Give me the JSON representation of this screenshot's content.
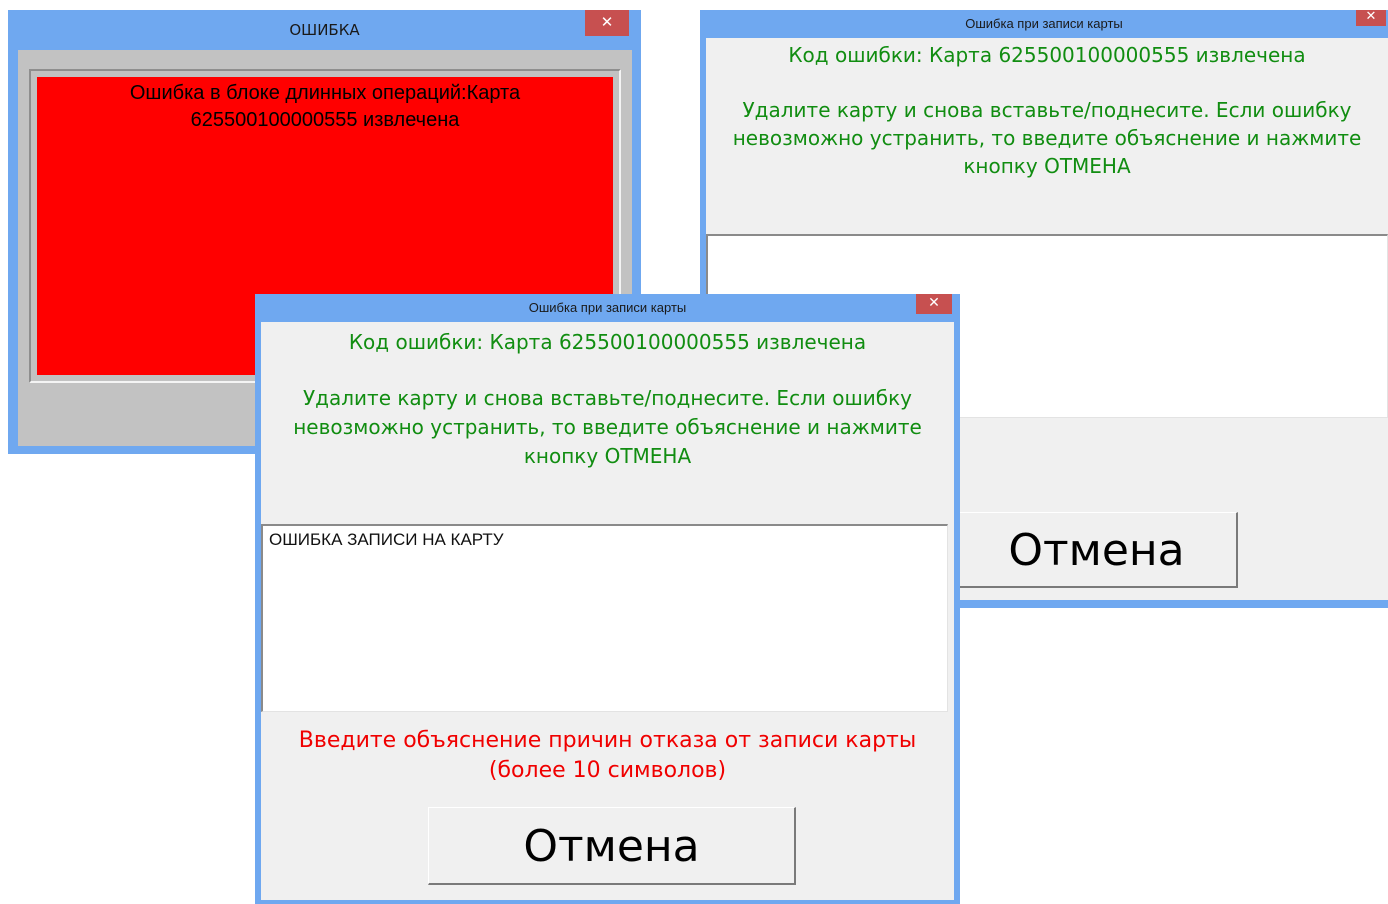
{
  "window_error": {
    "title": "ОШИБКА",
    "close_glyph": "✕",
    "message_line1": "Ошибка в блоке длинных операций:Карта",
    "message_line2": "625500100000555 извлечена",
    "message_bg_color": "#ff0000"
  },
  "window_back": {
    "title": "Ошибка при записи карты",
    "close_glyph": "✕",
    "error_code": "Код ошибки: Карта 625500100000555 извлечена",
    "info_line1": "Удалите карту и снова вставьте/поднесите. Если ошибку",
    "info_line2": "невозможно устранить, то введите объяснение и нажмите",
    "info_line3": "кнопку ОТМЕНА",
    "memo_text": "",
    "cancel_label": "Отмена"
  },
  "window_front": {
    "title": "Ошибка при записи карты",
    "close_glyph": "✕",
    "error_code": "Код ошибки: Карта 625500100000555 извлечена",
    "info_line1": "Удалите карту и снова вставьте/поднесите. Если ошибку",
    "info_line2": "невозможно устранить, то введите объяснение и нажмите",
    "info_line3": "кнопку ОТМЕНА",
    "memo_text": "ОШИБКА ЗАПИСИ НА КАРТУ",
    "hint_line1": "Введите объяснение причин отказа от записи карты",
    "hint_line2": "(более 10 символов)",
    "cancel_label": "Отмена"
  },
  "colors": {
    "title_bar": "#6fa8f0",
    "close_button": "#c75050",
    "info_text": "#118d11",
    "hint_text": "#f00000"
  }
}
